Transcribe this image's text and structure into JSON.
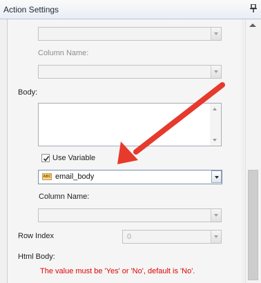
{
  "window": {
    "title": "Action Settings",
    "pin_icon": "pin-icon"
  },
  "top_field": {
    "value": ""
  },
  "top_column": {
    "label": "Column Name:",
    "value": ""
  },
  "body": {
    "label": "Body:",
    "value": ""
  },
  "use_variable": {
    "label": "Use Variable",
    "checked": true
  },
  "variable_select": {
    "value": "email_body",
    "icon": "abc-variable-icon",
    "icon_text": "ABC"
  },
  "column_name": {
    "label": "Column Name:",
    "value": ""
  },
  "row_index": {
    "label": "Row Index",
    "value": "0"
  },
  "html_body": {
    "label": "Html Body:"
  },
  "validation_message": "The value must be 'Yes' or 'No', default is 'No'.",
  "colors": {
    "arrow": "#e53a2c",
    "error": "#e00000"
  }
}
